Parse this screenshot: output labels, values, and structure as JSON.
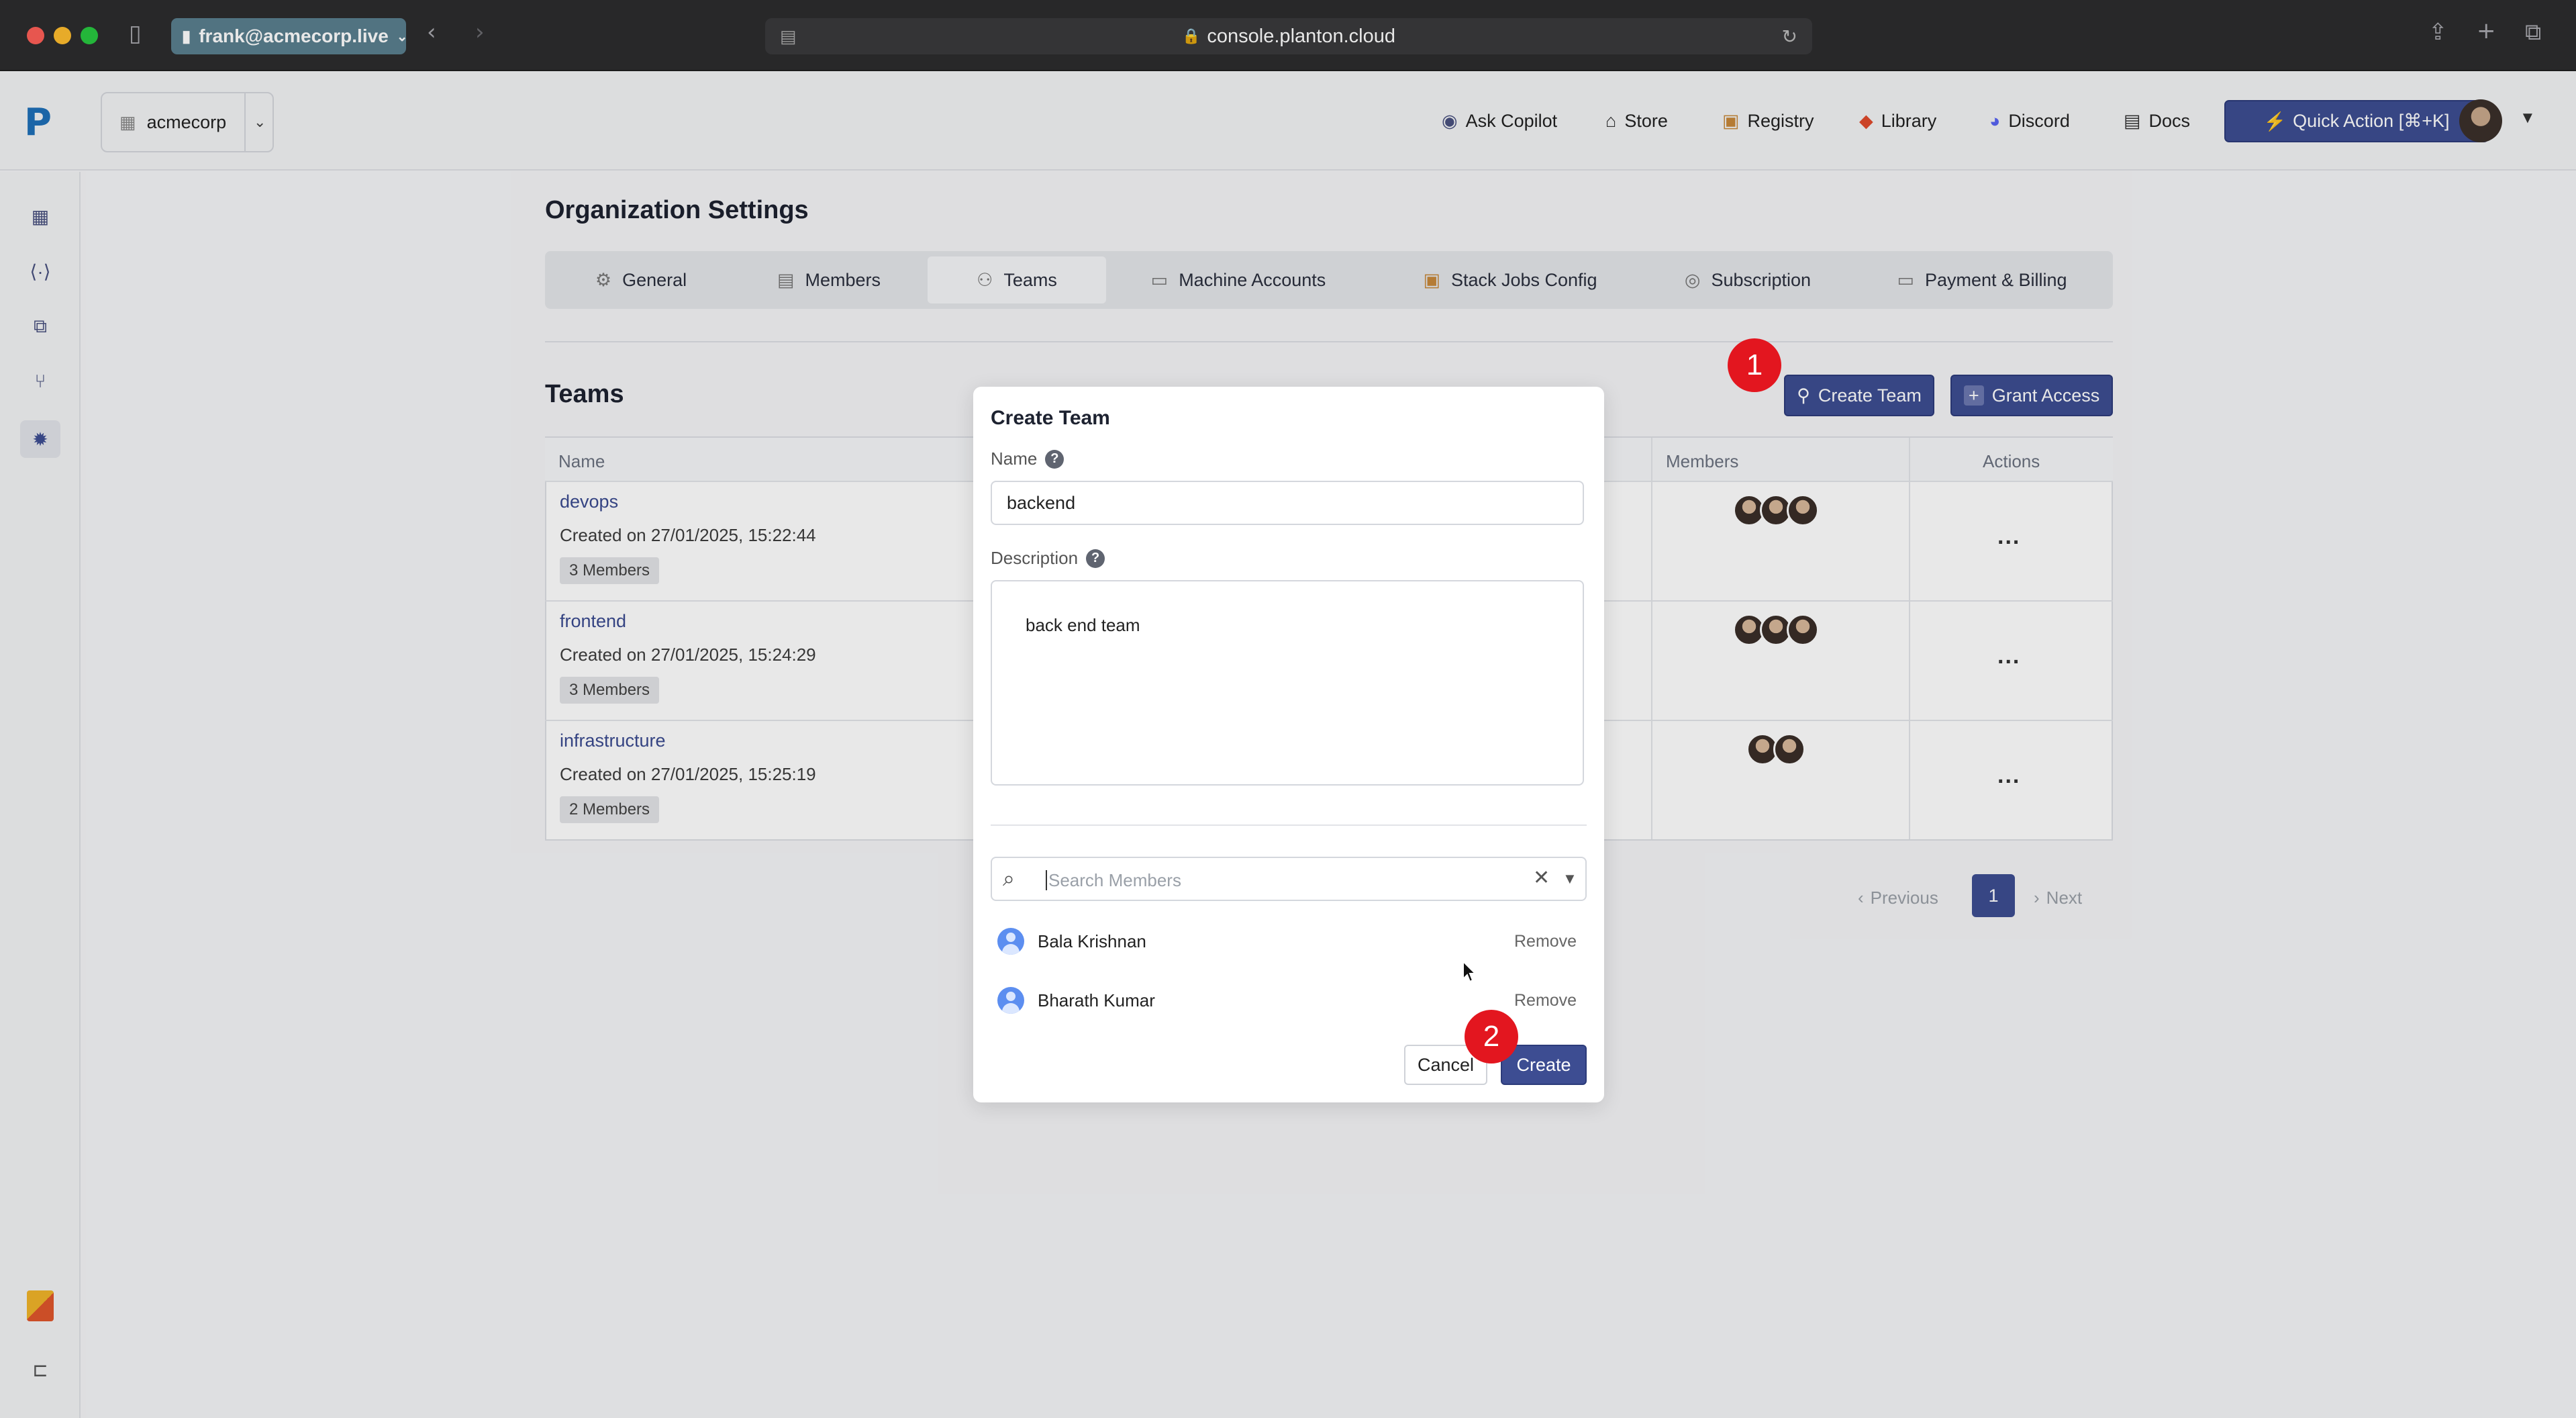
{
  "browser": {
    "profile": "frank@acmecorp.live",
    "url": "console.planton.cloud"
  },
  "header": {
    "org": "acmecorp",
    "links": [
      "Ask Copilot",
      "Store",
      "Registry",
      "Library",
      "Discord",
      "Docs"
    ],
    "quick_action": "Quick Action [⌘+K]"
  },
  "page": {
    "title": "Organization Settings",
    "tabs": [
      "General",
      "Members",
      "Teams",
      "Machine Accounts",
      "Stack Jobs Config",
      "Subscription",
      "Payment & Billing"
    ],
    "active_tab": "Teams"
  },
  "teams": {
    "title": "Teams",
    "create_button": "Create Team",
    "grant_button": "Grant Access",
    "columns": [
      "Name",
      "Members",
      "Actions"
    ],
    "rows": [
      {
        "name": "devops",
        "created": "Created on 27/01/2025, 15:22:44",
        "members": "3 Members",
        "member_count": 3,
        "actions": "..."
      },
      {
        "name": "frontend",
        "created": "Created on 27/01/2025, 15:24:29",
        "members": "3 Members",
        "member_count": 3,
        "actions": "..."
      },
      {
        "name": "infrastructure",
        "created": "Created on 27/01/2025, 15:25:19",
        "members": "2 Members",
        "member_count": 2,
        "actions": "..."
      }
    ],
    "pagination": {
      "previous": "Previous",
      "current": "1",
      "next": "Next"
    }
  },
  "modal": {
    "title": "Create Team",
    "name_label": "Name",
    "name_value": "backend",
    "description_label": "Description",
    "description_value": "back end team",
    "search_placeholder": "Search Members",
    "members": [
      {
        "name": "Bala Krishnan",
        "action": "Remove"
      },
      {
        "name": "Bharath Kumar",
        "action": "Remove"
      }
    ],
    "cancel": "Cancel",
    "create": "Create"
  },
  "annotations": [
    "1",
    "2"
  ],
  "colors": {
    "primary": "#3d4d92",
    "annotation": "#e3161f",
    "link": "#3a4a8f"
  }
}
